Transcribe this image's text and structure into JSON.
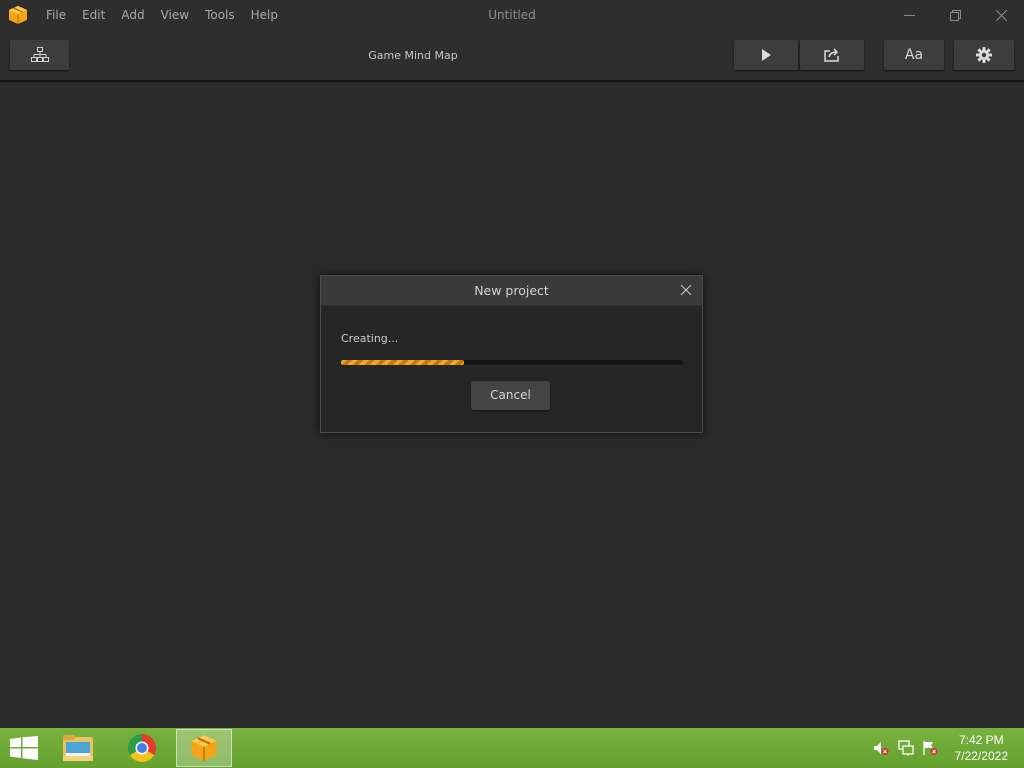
{
  "app": {
    "window_title": "Untitled",
    "menu": [
      "File",
      "Edit",
      "Add",
      "View",
      "Tools",
      "Help"
    ],
    "icons": {
      "logo": "package-box-icon",
      "minimize": "minimize-icon",
      "restore": "restore-icon",
      "close": "close-icon"
    }
  },
  "toolbar": {
    "title": "Game Mind Map",
    "font_button_label": "Aa",
    "icons": {
      "hierarchy": "hierarchy-icon",
      "play": "play-icon",
      "export": "export-icon",
      "settings": "gear-icon"
    }
  },
  "dialog": {
    "title": "New project",
    "status": "Creating...",
    "progress_fraction": 0.36,
    "cancel_label": "Cancel"
  },
  "taskbar": {
    "items": [
      "file-explorer-icon",
      "chrome-icon",
      "game-maker-icon"
    ],
    "tray": [
      "volume-muted-icon",
      "network-icon",
      "action-center-flag-icon"
    ],
    "time": "7:42 PM",
    "date": "7/22/2022"
  },
  "colors": {
    "accent": "#f5a623",
    "taskbar": "#6fa936",
    "background": "#2b2b2b"
  }
}
